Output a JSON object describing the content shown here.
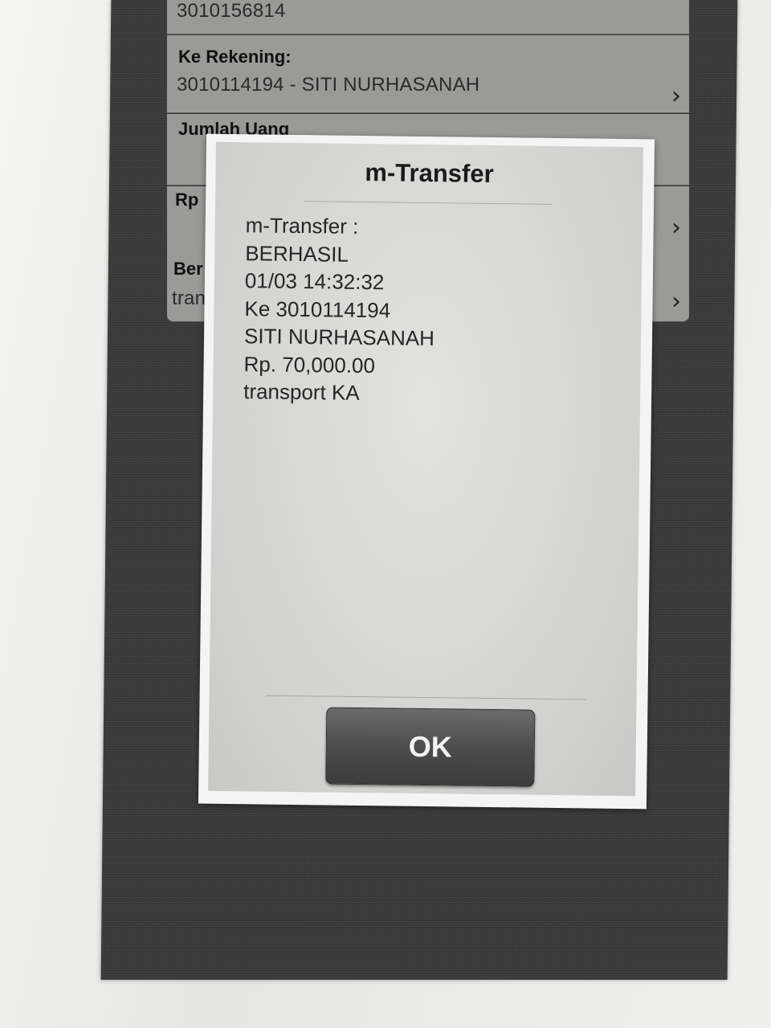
{
  "background_form": {
    "from_account_value": "3010156814",
    "to_account_label": "Ke Rekening:",
    "to_account_value": "3010114194 - SITI NURHASANAH",
    "amount_label": "Jumlah Uang",
    "amount_prefix": "Rp",
    "note_label_partial": "Ber",
    "note_value_partial": "tran"
  },
  "dialog": {
    "title": "m-Transfer",
    "lines": [
      "m-Transfer :",
      "BERHASIL",
      "01/03 14:32:32",
      "Ke 3010114194",
      "SITI NURHASANAH",
      "Rp. 70,000.00",
      "transport KA"
    ],
    "ok_label": "OK"
  },
  "icons": {
    "chevron": "chevron-right-icon"
  }
}
